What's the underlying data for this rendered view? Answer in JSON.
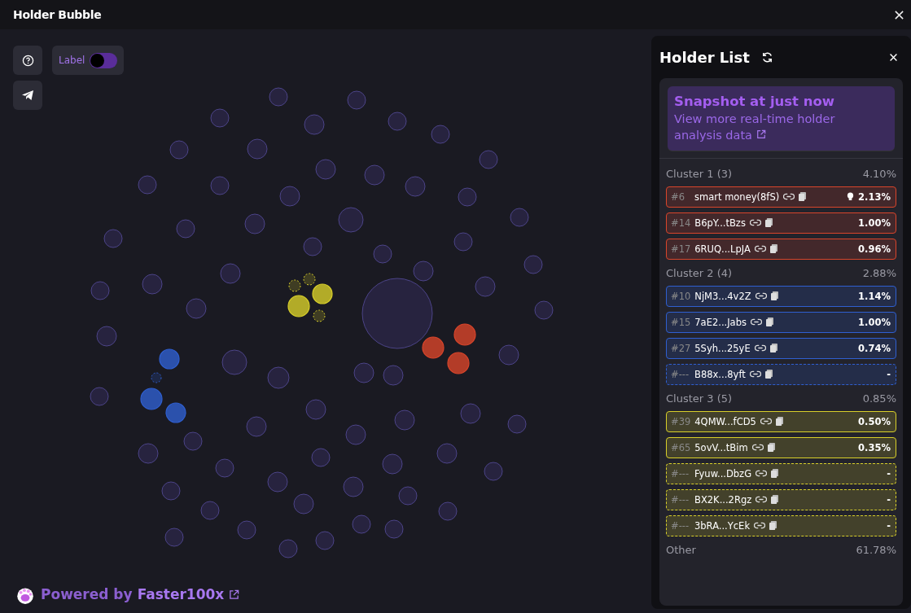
{
  "window": {
    "title": "Holder Bubble"
  },
  "label_toggle": {
    "label": "Label",
    "on": false
  },
  "panel": {
    "title": "Holder List",
    "snapshot": {
      "title": "Snapshot at just now",
      "link": "View more real-time holder analysis data"
    },
    "clusters": [
      {
        "name": "Cluster 1 (3)",
        "share": "4.10%",
        "color": "#d9452b",
        "holders": [
          {
            "rank": "#6",
            "address": "smart money(8fS)",
            "share": "2.13%",
            "kind": "ranked",
            "tagged": true
          },
          {
            "rank": "#14",
            "address": "B6pY...tBzs",
            "share": "1.00%",
            "kind": "ranked",
            "tagged": false
          },
          {
            "rank": "#17",
            "address": "6RUQ...LpJA",
            "share": "0.96%",
            "kind": "ranked",
            "tagged": false
          }
        ]
      },
      {
        "name": "Cluster 2 (4)",
        "share": "2.88%",
        "color": "#2f5fd0",
        "holders": [
          {
            "rank": "#10",
            "address": "NjM3...4v2Z",
            "share": "1.14%",
            "kind": "ranked",
            "tagged": false
          },
          {
            "rank": "#15",
            "address": "7aE2...Jabs",
            "share": "1.00%",
            "kind": "ranked",
            "tagged": false
          },
          {
            "rank": "#27",
            "address": "5Syh...25yE",
            "share": "0.74%",
            "kind": "ranked",
            "tagged": false
          },
          {
            "rank": "#---",
            "address": "B88x...8yft",
            "share": "-",
            "kind": "unranked",
            "tagged": false
          }
        ]
      },
      {
        "name": "Cluster 3 (5)",
        "share": "0.85%",
        "color": "#d8cf2a",
        "holders": [
          {
            "rank": "#39",
            "address": "4QMW...fCD5",
            "share": "0.50%",
            "kind": "ranked",
            "tagged": false
          },
          {
            "rank": "#65",
            "address": "5ovV...tBim",
            "share": "0.35%",
            "kind": "ranked",
            "tagged": false
          },
          {
            "rank": "#---",
            "address": "Fyuw...DbzG",
            "share": "-",
            "kind": "unranked",
            "tagged": false
          },
          {
            "rank": "#---",
            "address": "BX2K...2Rgz",
            "share": "-",
            "kind": "unranked",
            "tagged": false
          },
          {
            "rank": "#---",
            "address": "3bRA...YcEk",
            "share": "-",
            "kind": "unranked",
            "tagged": false
          }
        ]
      }
    ],
    "other": {
      "name": "Other",
      "share": "61.78%"
    }
  },
  "footer": {
    "prefix": "Powered by",
    "brand": "Faster100x"
  }
}
